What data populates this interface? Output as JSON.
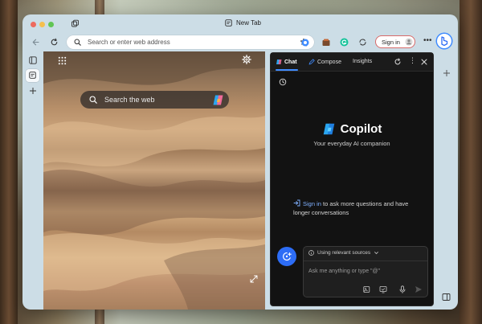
{
  "browser": {
    "tab_title": "New Tab",
    "address_placeholder": "Search or enter web address",
    "signin_label": "Sign in"
  },
  "newtab": {
    "search_placeholder": "Search the web"
  },
  "copilot": {
    "tabs": [
      {
        "label": "Chat",
        "active": true
      },
      {
        "label": "Compose",
        "active": false
      },
      {
        "label": "Insights",
        "active": false
      }
    ],
    "brand_name": "Copilot",
    "tagline": "Your everyday AI companion",
    "signin_link": "Sign in",
    "signin_rest": " to ask more questions and have longer conversations",
    "sources_label": "Using relevant sources",
    "input_placeholder": "Ask me anything or type \"@\""
  },
  "colors": {
    "accent": "#2d6df6",
    "link": "#7fb0ff",
    "panel_bg": "#121212",
    "window_bg": "#ccdde6"
  }
}
